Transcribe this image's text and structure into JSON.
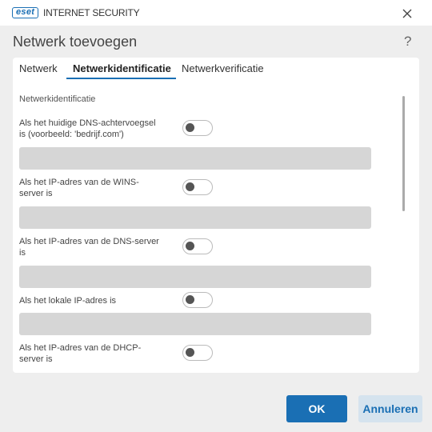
{
  "window": {
    "logo": "eset",
    "product": "INTERNET SECURITY"
  },
  "dialog": {
    "title": "Netwerk toevoegen",
    "help": "?"
  },
  "tabs": [
    {
      "label": "Netwerk",
      "active": false
    },
    {
      "label": "Netwerkidentificatie",
      "active": true
    },
    {
      "label": "Netwerkverificatie",
      "active": false
    }
  ],
  "section": {
    "title": "Netwerkidentificatie",
    "rows": [
      {
        "label_lines": [
          "Als het huidige DNS-achtervoegsel",
          "is (voorbeeld: 'bedrijf.com')"
        ],
        "enabled": false,
        "value": ""
      },
      {
        "label_lines": [
          "Als het IP-adres van de WINS-",
          "server is"
        ],
        "enabled": false,
        "value": ""
      },
      {
        "label_lines": [
          "Als het IP-adres van de DNS-server",
          "is"
        ],
        "enabled": false,
        "value": ""
      },
      {
        "label_lines": [
          "Als het lokale IP-adres is"
        ],
        "enabled": false,
        "value": ""
      },
      {
        "label_lines": [
          "Als het IP-adres van de DHCP-",
          "server is"
        ],
        "enabled": false
      }
    ]
  },
  "buttons": {
    "ok": "OK",
    "cancel": "Annuleren"
  },
  "colors": {
    "accent": "#1a6fb4",
    "background": "#eeeeee",
    "field": "#d6d6d6"
  }
}
